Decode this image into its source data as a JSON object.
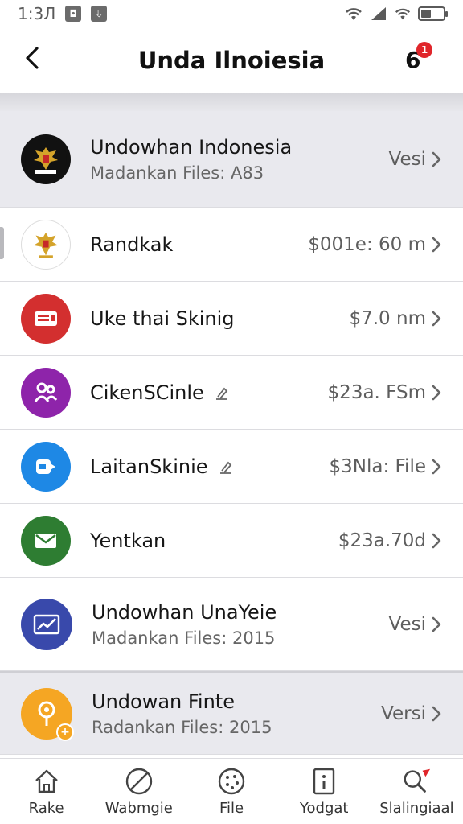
{
  "status": {
    "time": "1:3Л"
  },
  "header": {
    "title": "Unda Ilnoiesia",
    "notif_count": "6",
    "notif_badge": "1"
  },
  "list": [
    {
      "title": "Undowhan Indonesia",
      "subtitle": "Madankan Files: A83",
      "meta": "Vesi",
      "icon": "garuda-emblem-icon",
      "highlight": true
    },
    {
      "title": "Randkak",
      "subtitle": "",
      "meta": "$001e: 60 m",
      "icon": "garuda-emblem-icon",
      "highlight": false
    },
    {
      "title": "Uke thai Skinig",
      "subtitle": "",
      "meta": "$7.0 nm",
      "icon": "radio-icon",
      "highlight": false,
      "color": "#d32f2f"
    },
    {
      "title": "CikenSCinle",
      "subtitle": "",
      "meta": "$23a. FSm",
      "icon": "people-icon",
      "highlight": false,
      "color": "#8e24aa",
      "edit": true
    },
    {
      "title": "LaitanSkinie",
      "subtitle": "",
      "meta": "$3Nla: File",
      "icon": "tag-icon",
      "highlight": false,
      "color": "#1e88e5",
      "edit": true
    },
    {
      "title": "Yentkan",
      "subtitle": "",
      "meta": "$23a.70d",
      "icon": "mail-icon",
      "highlight": false,
      "color": "#2e7d32"
    },
    {
      "title": "Undowhan UnaYeie",
      "subtitle": "Madankan Files: 2015",
      "meta": "Vesi",
      "icon": "chart-icon",
      "highlight": false,
      "color": "#3949ab"
    },
    {
      "title": "Undowan Finte",
      "subtitle": "Radankan Files: 2015",
      "meta": "Versi",
      "icon": "location-pin-icon",
      "highlight": true,
      "color": "#f5a623"
    }
  ],
  "nav": [
    {
      "label": "Rake",
      "icon": "home-icon"
    },
    {
      "label": "Wabmgie",
      "icon": "no-symbol-icon"
    },
    {
      "label": "File",
      "icon": "palette-icon"
    },
    {
      "label": "Yodgat",
      "icon": "info-card-icon"
    },
    {
      "label": "Slalingiaal",
      "icon": "search-icon"
    }
  ]
}
